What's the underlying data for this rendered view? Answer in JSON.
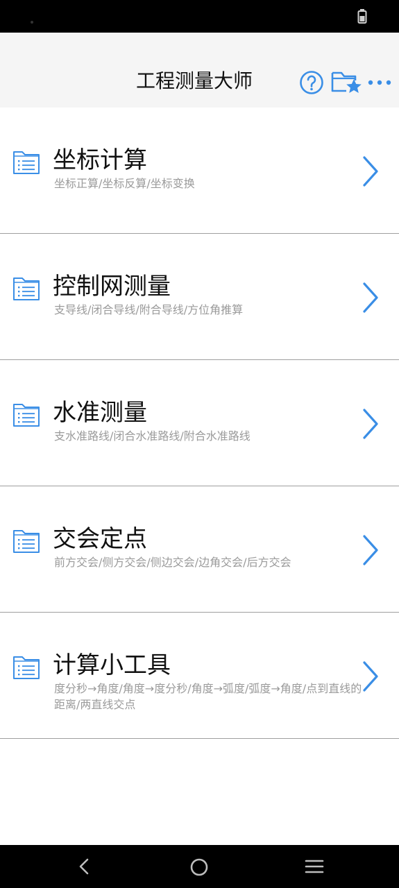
{
  "app": {
    "title": "工程测量大师"
  },
  "toolbar": {
    "help_icon": "help-circle-icon",
    "favorites_icon": "folder-star-icon",
    "more_icon": "more-horizontal-icon",
    "accent_color": "#3a8ee6"
  },
  "menu": {
    "items": [
      {
        "title": "坐标计算",
        "subtitle": "坐标正算/坐标反算/坐标变换",
        "icon": "folder-list-icon"
      },
      {
        "title": "控制网测量",
        "subtitle": "支导线/闭合导线/附合导线/方位角推算",
        "icon": "folder-list-icon"
      },
      {
        "title": "水准测量",
        "subtitle": "支水准路线/闭合水准路线/附合水准路线",
        "icon": "folder-list-icon"
      },
      {
        "title": "交会定点",
        "subtitle": "前方交会/侧方交会/侧边交会/边角交会/后方交会",
        "icon": "folder-list-icon"
      },
      {
        "title": "计算小工具",
        "subtitle": "度分秒→角度/角度→度分秒/角度→弧度/弧度→角度/点到直线的距离/两直线交点",
        "icon": "folder-list-icon"
      }
    ]
  },
  "system": {
    "battery_icon": "battery-icon",
    "nav_back_icon": "back-icon",
    "nav_home_icon": "home-icon",
    "nav_menu_icon": "menu-icon"
  }
}
